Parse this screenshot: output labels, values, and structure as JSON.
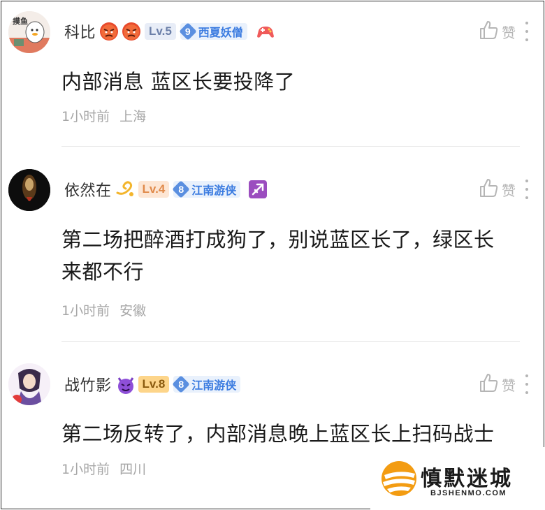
{
  "comments": [
    {
      "username": "科比",
      "level": "Lv.5",
      "fan_level": "9",
      "fan_name": "西夏妖僧",
      "content_lines": [
        "内部消息 蓝区长要投降了"
      ],
      "time": "1小时前",
      "location": "上海",
      "like_label": "赞",
      "avatar_text": "摸鱼"
    },
    {
      "username": "依然在",
      "level": "Lv.4",
      "fan_level": "8",
      "fan_name": "江南游侠",
      "content_lines": [
        "第二场把醉酒打成狗了，别说蓝区长了，绿区长",
        "来都不行"
      ],
      "time": "1小时前",
      "location": "安徽",
      "like_label": "赞"
    },
    {
      "username": "战竹影",
      "level": "Lv.8",
      "fan_level": "8",
      "fan_name": "江南游侠",
      "content_lines": [
        "第二场反转了，内部消息晚上蓝区长上扫码战士"
      ],
      "time": "1小时前",
      "location": "四川",
      "like_label": "赞"
    }
  ],
  "watermark": {
    "title": "慎默迷城",
    "url": "BJSHENMO.COM"
  },
  "colors": {
    "accent_blue": "#3a7be0",
    "meta_gray": "#a6a6a6",
    "brand_orange": "#f39c12"
  }
}
